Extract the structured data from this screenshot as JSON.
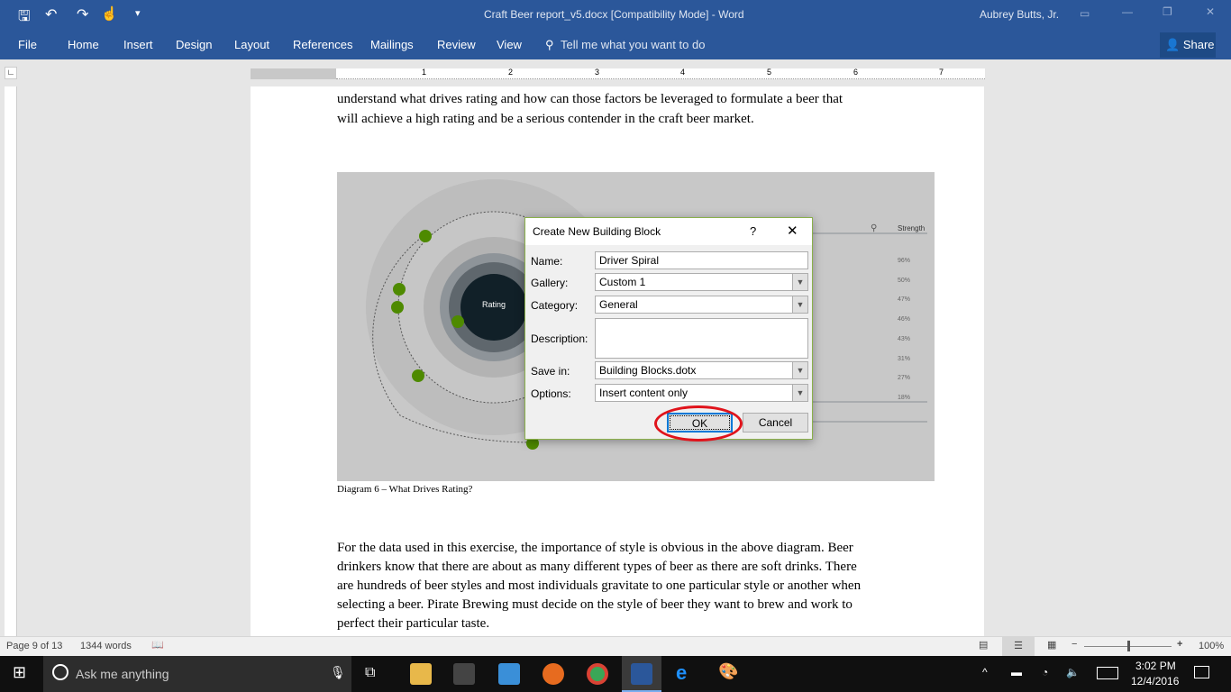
{
  "window": {
    "title": "Craft Beer report_v5.docx [Compatibility Mode] - Word",
    "user": "Aubrey Butts, Jr.",
    "share": "Share"
  },
  "ribbon": {
    "tabs": [
      "File",
      "Home",
      "Insert",
      "Design",
      "Layout",
      "References",
      "Mailings",
      "Review",
      "View"
    ],
    "tell_me": "Tell me what you want to do"
  },
  "ruler": {
    "marks": [
      "1",
      "1",
      "2",
      "3",
      "4",
      "5",
      "6",
      "7"
    ]
  },
  "document": {
    "intro_lines": [
      "understand what drives rating and how can those factors be leveraged to formulate a beer that",
      "will achieve a high rating and be a serious contender in the craft beer market."
    ],
    "figure": {
      "center_label": "Rating",
      "column_header": "Strength",
      "values": [
        "96%",
        "50%",
        "47%",
        "46%",
        "43%",
        "31%",
        "27%",
        "18%"
      ]
    },
    "caption": "Diagram 6 – What Drives Rating?",
    "paragraph_lines": [
      "For the data used in this exercise, the importance of style is obvious in the above diagram.  Beer",
      "drinkers know that there are about as many different types of beer as there are soft drinks.  There",
      "are hundreds of beer styles and most individuals gravitate to one particular style or another when",
      "selecting a beer.  Pirate Brewing must decide on the style of beer they want to brew and work to",
      "perfect their particular taste."
    ]
  },
  "dialog": {
    "title": "Create New Building Block",
    "help": "?",
    "labels": {
      "name": "Name:",
      "gallery": "Gallery:",
      "category": "Category:",
      "description": "Description:",
      "save_in": "Save in:",
      "options": "Options:"
    },
    "values": {
      "name": "Driver Spiral",
      "gallery": "Custom 1",
      "category": "General",
      "description": "",
      "save_in": "Building Blocks.dotx",
      "options": "Insert content only"
    },
    "ok": "OK",
    "cancel": "Cancel",
    "highlight_color": "#e0131b"
  },
  "status": {
    "page": "Page 9 of 13",
    "words": "1344 words",
    "zoom": "100%",
    "zoom_level": 100
  },
  "taskbar": {
    "search": "Ask me anything",
    "time": "3:02 PM",
    "date": "12/4/2016"
  },
  "colors": {
    "word_blue": "#2b579a",
    "accent_green": "#4e8a00"
  }
}
